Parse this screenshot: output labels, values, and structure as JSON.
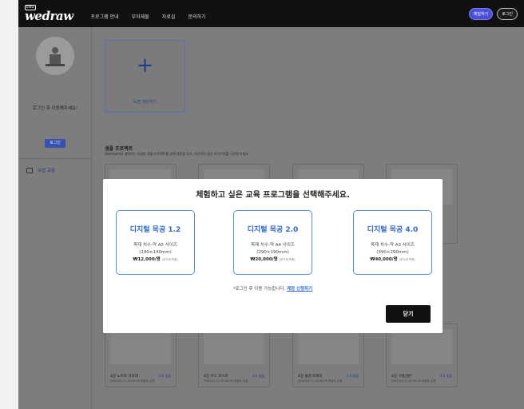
{
  "header": {
    "logo_badge": "Edu",
    "logo_word": "wedraw",
    "nav": [
      "프로그램 안내",
      "부자재몰",
      "자료실",
      "문의하기"
    ],
    "trial_button": "체험하기",
    "login_button": "로그인"
  },
  "sidebar": {
    "login_message": "로그인 후 이용해주세요!",
    "login_button": "로그인",
    "menu_item": "수업 교실"
  },
  "main": {
    "new_drawing_label": "도면 생성하기",
    "sample_title": "샘플 프로젝트",
    "sample_desc": "Wedraw에서 제안하는 다양한 샘플 프로젝트를 함께 열람을 보고, 자신만의 멋진 아이디어를 구상해 보세요",
    "cards": [
      {
        "name": "4강 노트북 거치대",
        "tag": "4.0 샘플",
        "date": "2023.02.11 15:00:34 작성자 수정"
      },
      {
        "name": "4강 우드 코스터",
        "tag": "4.0 샘플",
        "date": "2023.02.11 15:00:34 작성자 수정"
      },
      {
        "name": "4강 물결 트레이",
        "tag": "4.0 샘플",
        "date": "2023.02.11 15:00:34 작성자 수정"
      },
      {
        "name": "4강 구름선반",
        "tag": "4.0 샘플",
        "date": "2023.02.11 15:00:34 작성자 수정"
      }
    ]
  },
  "modal": {
    "title": "체험하고 싶은 교육 프로그램을 선택해주세요.",
    "options": [
      {
        "title": "디지털 목공 1.2",
        "line1": "목재 치수-약 A5 사이즈",
        "line2": "(190×140mm)",
        "price": "₩12,000/명",
        "vat": "(부가세 포함)"
      },
      {
        "title": "디지털 목공 2.0",
        "line1": "목재 치수-약 A4 사이즈",
        "line2": "(290×190mm)",
        "price": "₩20,000/명",
        "vat": "(부가세 포함)"
      },
      {
        "title": "디지털 목공 4.0",
        "line1": "목재 치수-약 A3 사이즈",
        "line2": "(390×290mm)",
        "price": "₩40,000/명",
        "vat": "(부가세 포함)"
      }
    ],
    "note": "*로그인 후 이용 가능합니다.",
    "note_link": "계정 신청하기",
    "close_button": "닫기"
  }
}
